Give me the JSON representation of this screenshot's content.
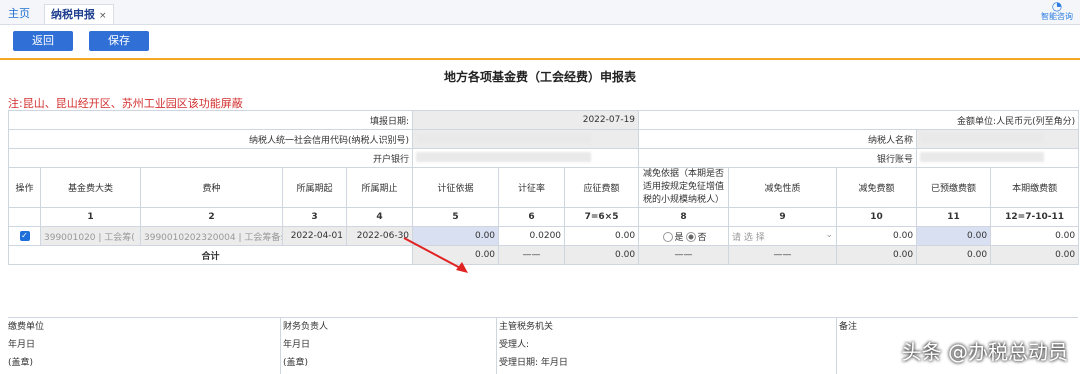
{
  "tabs": {
    "home": "主页",
    "active": "纳税申报",
    "close": "×"
  },
  "helper": {
    "label": "智能咨询",
    "icon": "chat-icon"
  },
  "buttons": {
    "back": "返回",
    "save": "保存"
  },
  "title": "地方各项基金费（工会经费）申报表",
  "note": "注:昆山、昆山经开区、苏州工业园区该功能屏蔽",
  "info": {
    "fill_date_label": "填报日期:",
    "fill_date": "2022-07-19",
    "unit_label": "金额单位:人民币元(列至角分)",
    "taxid_label": "纳税人统一社会信用代码(纳税人识别号)",
    "taxid_hint": "(",
    "name_label": "纳税人名称",
    "bank_label": "开户银行",
    "account_label": "银行账号"
  },
  "headers": [
    "操作",
    "基金费大类",
    "费种",
    "所属期起",
    "所属期止",
    "计征依据",
    "计征率",
    "应征费额",
    "减免依据（本期是否适用按规定免征增值税的小规模纳税人）",
    "减免性质",
    "减免费额",
    "已预缴费额",
    "本期缴费额"
  ],
  "col_nums": [
    "",
    "1",
    "2",
    "3",
    "4",
    "5",
    "6",
    "7=6×5",
    "8",
    "9",
    "10",
    "11",
    "12=7-10-11"
  ],
  "row": {
    "category": "399001020 | 工会筹(",
    "fee_type": "3990010202320004 | 工会筹备么",
    "start": "2022-04-01",
    "end": "2022-06-30",
    "basis": "0.00",
    "rate": "0.0200",
    "payable": "0.00",
    "yes": "是",
    "no": "否",
    "reduction_nature": "请 选 择",
    "reduction": "0.00",
    "prepaid": "0.00",
    "current": "0.00"
  },
  "total": {
    "label": "合计",
    "basis": "0.00",
    "dash": "——",
    "payable": "0.00",
    "reduction": "0.00",
    "prepaid": "0.00",
    "current": "0.00"
  },
  "footer": {
    "payer": "缴费单位",
    "date1": "年月日",
    "seal1": "(盖章)",
    "finance": "财务负责人",
    "date2": "年月日",
    "seal2": "(盖章)",
    "tax_office": "主管税务机关",
    "receiver": "受理人:",
    "receive_date": "受理日期:  年月日",
    "remarks": "备注"
  },
  "watermark": "头条 @办税总动员",
  "colors": {
    "accent": "#2f6fd6",
    "divider": "#f5a623",
    "note": "#d32f2f"
  }
}
